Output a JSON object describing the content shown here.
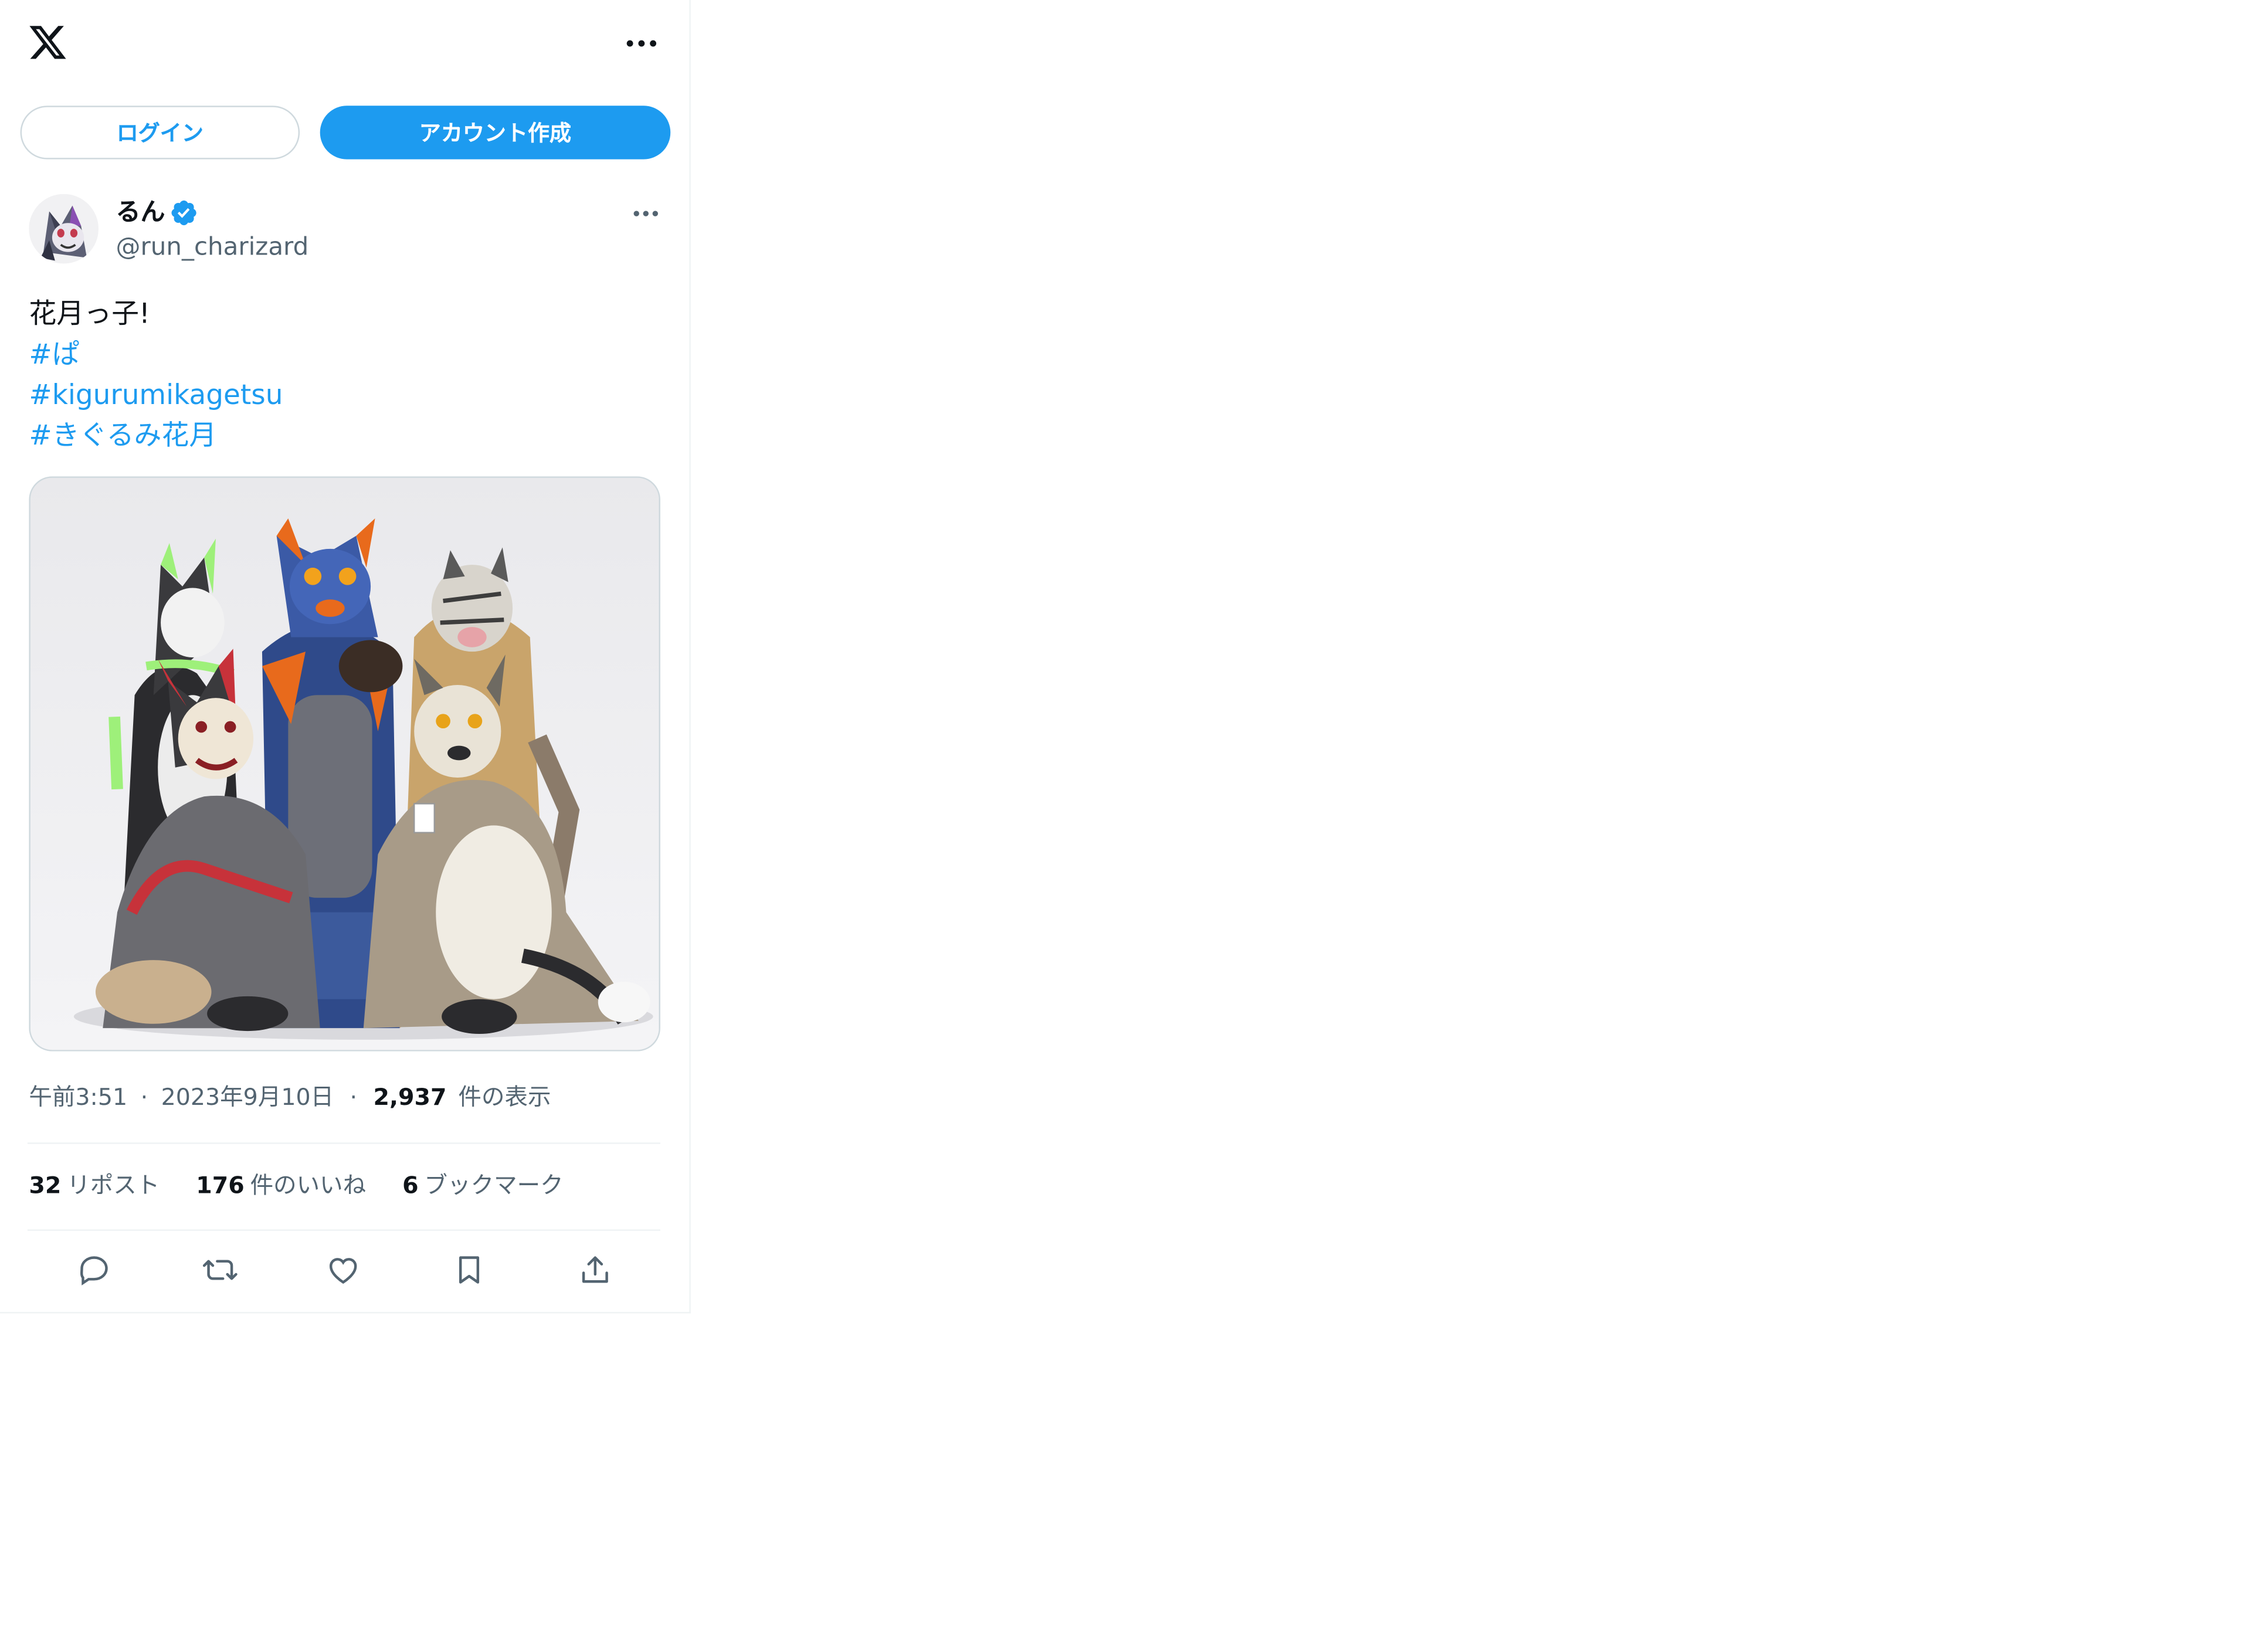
{
  "header": {
    "logo_icon": "x-logo-icon",
    "more_icon": "more-horizontal-icon"
  },
  "auth": {
    "login_label": "ログイン",
    "signup_label": "アカウント作成"
  },
  "tweet": {
    "author": {
      "display_name": "るん",
      "handle": "@run_charizard",
      "verified_icon": "verified-badge-icon"
    },
    "text": "花月っ子!",
    "hashtags": [
      "#ぱ",
      "#kigurumikagetsu",
      "#きぐるみ花月"
    ],
    "media": {
      "description_icon": "photo"
    },
    "meta": {
      "time": "午前3:51",
      "separator": "·",
      "date": "2023年9月10日",
      "views_count": "2,937",
      "views_label": "件の表示"
    },
    "stats": {
      "reposts_count": "32",
      "reposts_label": "リポスト",
      "likes_count": "176",
      "likes_label": "件のいいね",
      "bookmarks_count": "6",
      "bookmarks_label": "ブックマーク"
    },
    "actions": [
      "reply-icon",
      "repost-icon",
      "like-icon",
      "bookmark-icon",
      "share-icon"
    ]
  },
  "colors": {
    "accent": "#1d9bf0",
    "text_primary": "#0f1419",
    "text_secondary": "#536471",
    "border": "#eff3f4"
  }
}
